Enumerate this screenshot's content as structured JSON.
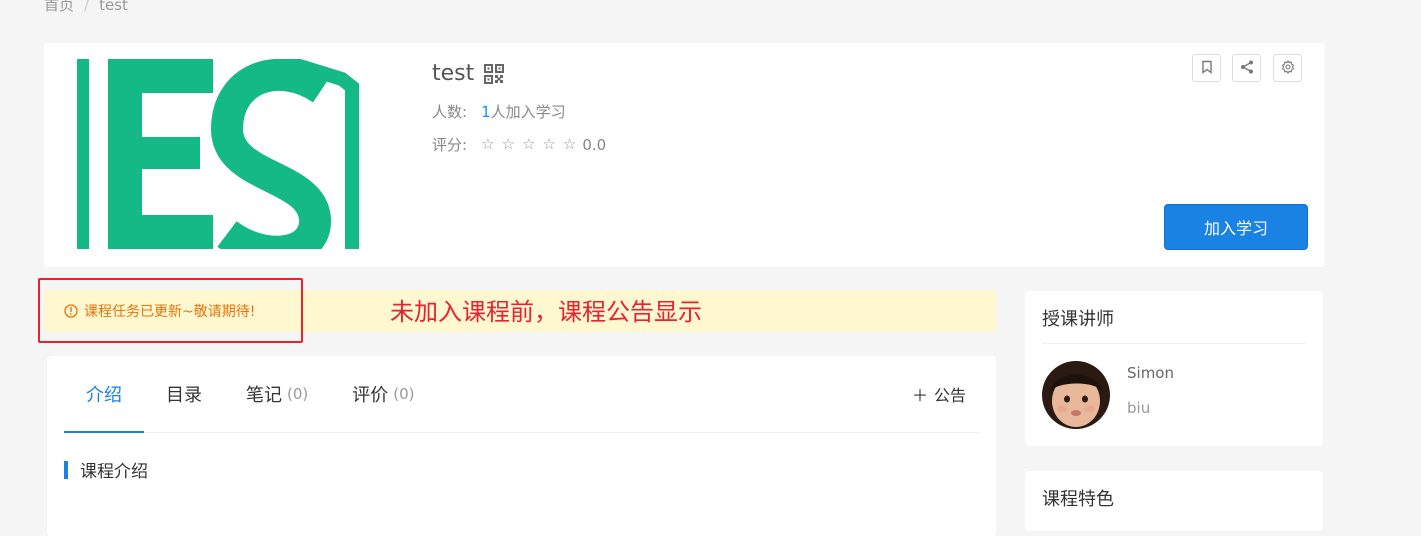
{
  "breadcrumb": {
    "home": "首页",
    "separator": "/",
    "current": "test"
  },
  "course": {
    "title": "test",
    "students_label": "人数:",
    "students_count": "1",
    "students_suffix": "人加入学习",
    "rating_label": "评分:",
    "rating_stars": 0,
    "rating_score": "0.0",
    "join_button": "加入学习",
    "brand_color": "#14b986"
  },
  "toolbar": {
    "bookmark_icon": "bookmark-icon",
    "share_icon": "share-icon",
    "settings_icon": "gear-icon"
  },
  "notice": {
    "text": "课程任务已更新~敬请期待!",
    "annotation": "未加入课程前，课程公告显示"
  },
  "tabs": {
    "items": [
      {
        "label": "介绍",
        "count": ""
      },
      {
        "label": "目录",
        "count": ""
      },
      {
        "label": "笔记",
        "count": "(0)"
      },
      {
        "label": "评价",
        "count": "(0)"
      }
    ],
    "add_notice": "公告",
    "active_index": 0
  },
  "intro": {
    "section_title": "课程介绍"
  },
  "teacher": {
    "title": "授课讲师",
    "name": "Simon",
    "subtitle": "biu"
  },
  "features": {
    "title": "课程特色"
  },
  "colors": {
    "accent": "#1a82e2",
    "notice_bg": "#fef7d0",
    "notice_text": "#e8740a",
    "annotation_red": "#e8222e"
  }
}
